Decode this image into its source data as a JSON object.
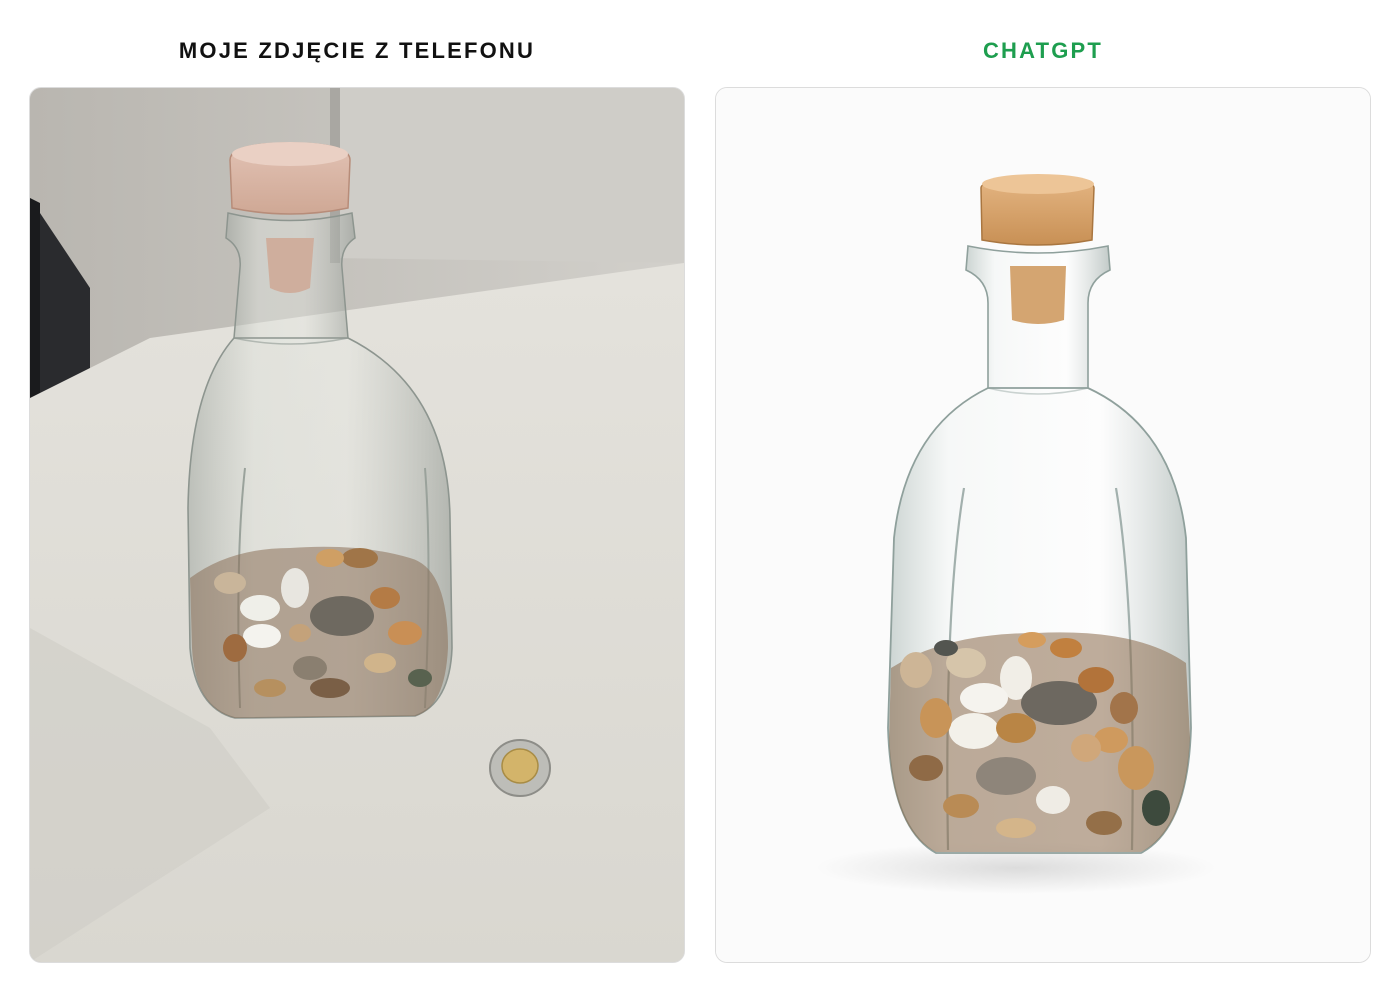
{
  "panels": [
    {
      "caption": "MOJE ZDJĘCIE Z TELEFONU",
      "caption_color": "#111111",
      "content": "phone-photo"
    },
    {
      "caption": "CHATGPT",
      "caption_color": "#1e9e4f",
      "content": "generated-image"
    }
  ]
}
